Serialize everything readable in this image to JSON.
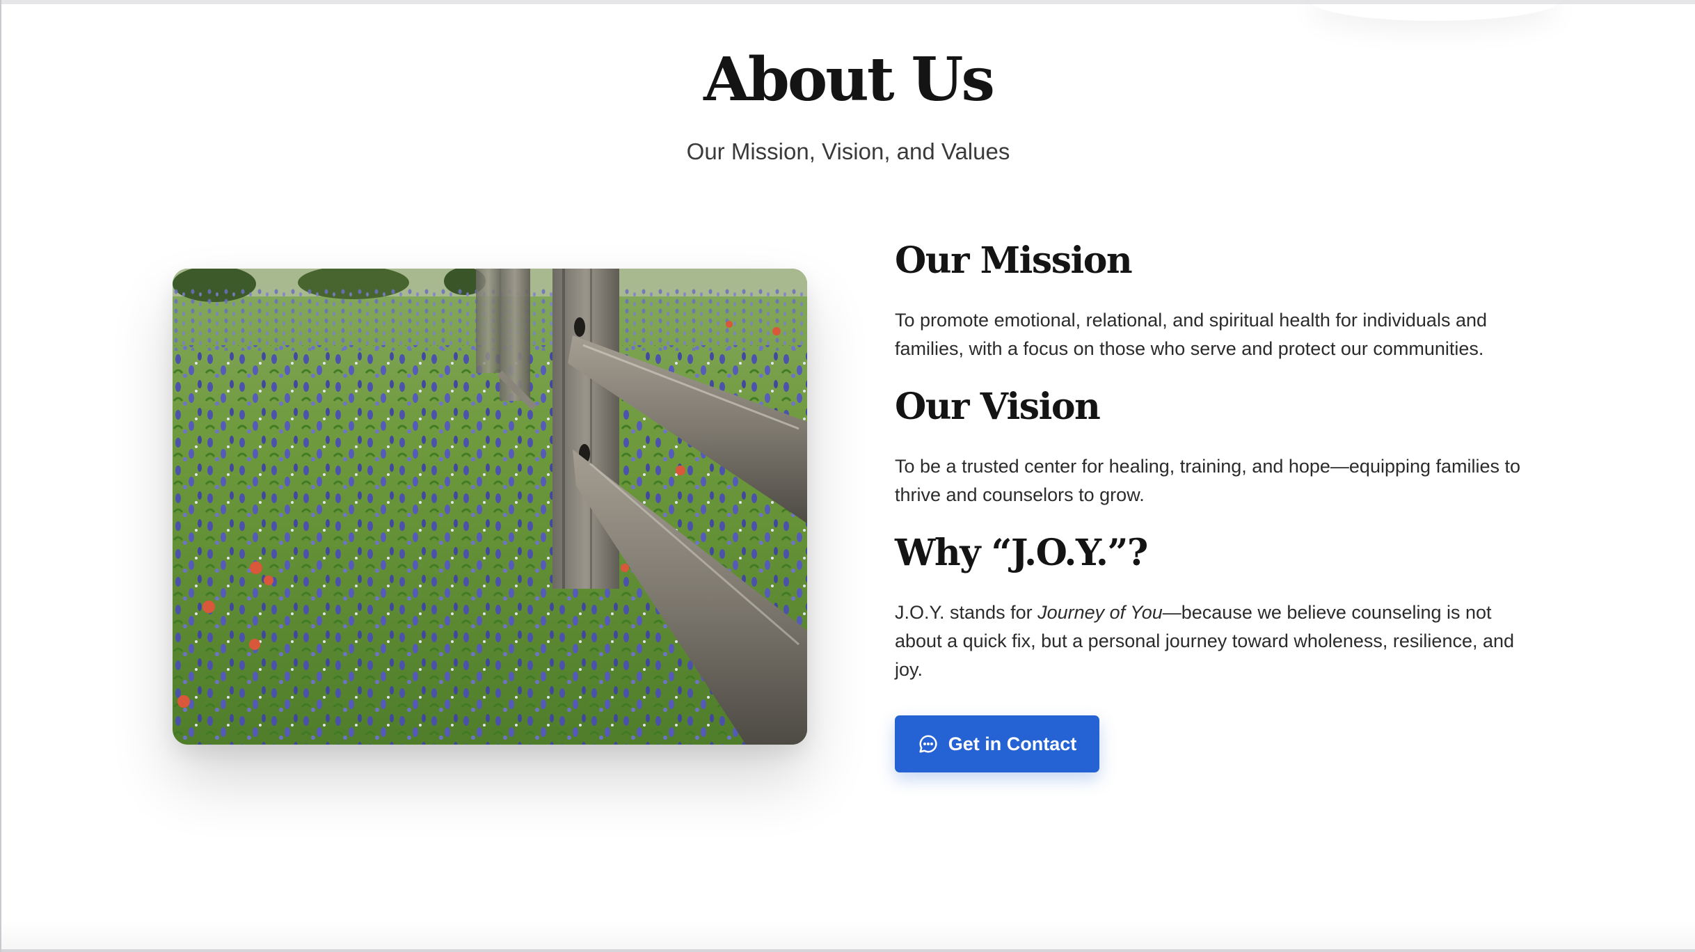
{
  "header": {
    "title": "About Us",
    "subtitle": "Our Mission, Vision, and Values"
  },
  "image": {
    "alt": "Bluebonnets and red wildflowers along a weathered split-rail wooden fence"
  },
  "sections": [
    {
      "heading": "Our Mission",
      "body": "To promote emotional, relational, and spiritual health for individuals and families, with a focus on those who serve and protect our communities."
    },
    {
      "heading": "Our Vision",
      "body": "To be a trusted center for healing, training, and hope—equipping families to thrive and counselors to grow."
    },
    {
      "heading": "Why “J.O.Y.”?",
      "body_prefix": "J.O.Y. stands for ",
      "body_emphasis": "Journey of You",
      "body_suffix": "—because we believe counseling is not about a quick fix, but a personal journey toward wholeness, resilience, and joy."
    }
  ],
  "cta": {
    "label": "Get in Contact",
    "icon": "chat-bubble-icon"
  },
  "colors": {
    "accent": "#2563d4",
    "heading": "#141414",
    "body_text": "#2b2b2b"
  }
}
